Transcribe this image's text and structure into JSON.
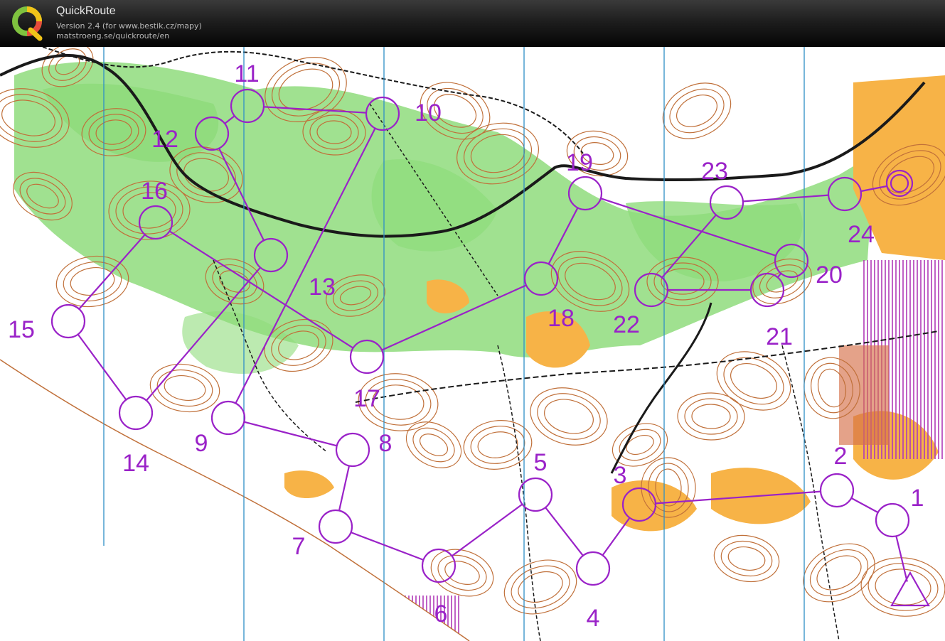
{
  "app": {
    "name": "QuickRoute",
    "version_line": "Version 2.4  (for www.bestik.cz/mapy)",
    "url_line": "matstroeng.se/quickroute/en",
    "logo_letter": "Q"
  },
  "map": {
    "course_color": "#9a22c8",
    "vegetation_color": "#8fdc7c",
    "open_land_color": "#f7b347",
    "contour_color": "#c0703a",
    "meridian_color": "#2e8fc6",
    "track_color": "#1a1a1a",
    "start_label": "",
    "controls": [
      {
        "number": "2"
      },
      {
        "number": "3"
      },
      {
        "number": "4"
      },
      {
        "number": "5"
      },
      {
        "number": "6"
      },
      {
        "number": "7"
      },
      {
        "number": "8"
      },
      {
        "number": "9"
      },
      {
        "number": "10"
      },
      {
        "number": "11"
      },
      {
        "number": "12"
      },
      {
        "number": "13"
      },
      {
        "number": "14"
      },
      {
        "number": "15"
      },
      {
        "number": "16"
      },
      {
        "number": "17"
      },
      {
        "number": "18"
      },
      {
        "number": "19"
      },
      {
        "number": "20"
      },
      {
        "number": "21"
      },
      {
        "number": "22"
      },
      {
        "number": "23"
      },
      {
        "number": "24"
      },
      {
        "number": "1"
      }
    ]
  }
}
